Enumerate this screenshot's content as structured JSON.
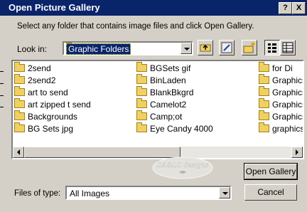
{
  "window": {
    "title": "Open Picture Gallery",
    "help_glyph": "?",
    "close_glyph": "X"
  },
  "instructions": "Select any folder that contains image files and click Open Gallery.",
  "look_in": {
    "label": "Look in:",
    "value": "Graphic Folders"
  },
  "files": {
    "column1": [
      "2send",
      "2send2",
      "art to send",
      "art zipped t send",
      "Backgrounds",
      "BG Sets jpg"
    ],
    "column2": [
      "BGSets gif",
      "BinLaden",
      "BlankBkgrd",
      "Camelot2",
      "Camp;ot",
      "Eye Candy 4000"
    ],
    "column3": [
      "for Di",
      "Graphics",
      "Graphics",
      "Graphics",
      "Graphics",
      "graphicst"
    ]
  },
  "watermark": "DA&LC designs",
  "buttons": {
    "open": "Open Gallery",
    "cancel": "Cancel"
  },
  "files_of_type": {
    "label": "Files of type:",
    "value": "All Images"
  },
  "colors": {
    "titlebar": "#0a246a",
    "selection": "#0a246a",
    "folder": "#f0d060",
    "face": "#d4d0c8"
  }
}
